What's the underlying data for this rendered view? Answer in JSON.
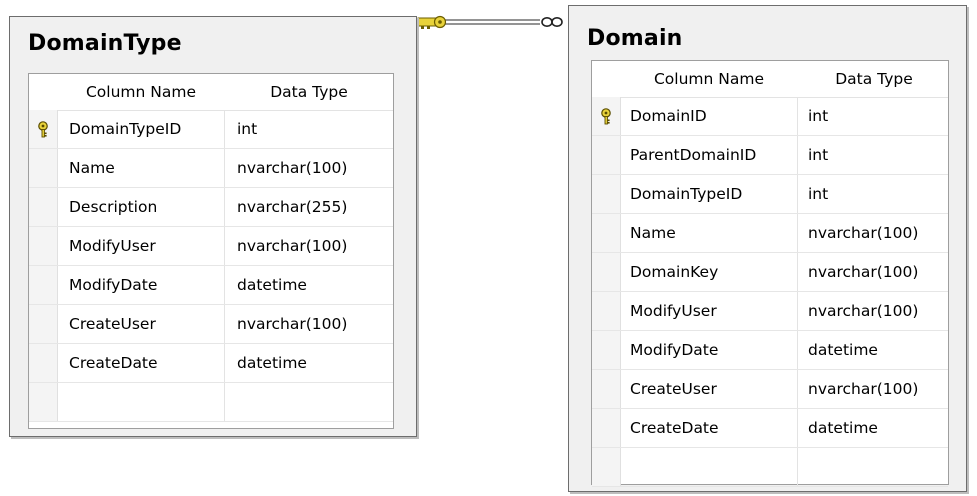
{
  "colors": {
    "background": "#ffffff",
    "box_background": "#f0f0f0",
    "border": "#6d6d6d",
    "key_yellow": "#e8d23a"
  },
  "relationship": {
    "one_end_icon": "key-icon",
    "many_end_icon": "infinity-icon"
  },
  "tables": [
    {
      "title": "DomainType",
      "header": {
        "column_name": "Column Name",
        "data_type": "Data Type"
      },
      "rows": [
        {
          "name": "DomainTypeID",
          "type": "int",
          "primary_key": true
        },
        {
          "name": "Name",
          "type": "nvarchar(100)",
          "primary_key": false
        },
        {
          "name": "Description",
          "type": "nvarchar(255)",
          "primary_key": false
        },
        {
          "name": "ModifyUser",
          "type": "nvarchar(100)",
          "primary_key": false
        },
        {
          "name": "ModifyDate",
          "type": "datetime",
          "primary_key": false
        },
        {
          "name": "CreateUser",
          "type": "nvarchar(100)",
          "primary_key": false
        },
        {
          "name": "CreateDate",
          "type": "datetime",
          "primary_key": false
        }
      ]
    },
    {
      "title": "Domain",
      "header": {
        "column_name": "Column Name",
        "data_type": "Data Type"
      },
      "rows": [
        {
          "name": "DomainID",
          "type": "int",
          "primary_key": true
        },
        {
          "name": "ParentDomainID",
          "type": "int",
          "primary_key": false
        },
        {
          "name": "DomainTypeID",
          "type": "int",
          "primary_key": false
        },
        {
          "name": "Name",
          "type": "nvarchar(100)",
          "primary_key": false
        },
        {
          "name": "DomainKey",
          "type": "nvarchar(100)",
          "primary_key": false
        },
        {
          "name": "ModifyUser",
          "type": "nvarchar(100)",
          "primary_key": false
        },
        {
          "name": "ModifyDate",
          "type": "datetime",
          "primary_key": false
        },
        {
          "name": "CreateUser",
          "type": "nvarchar(100)",
          "primary_key": false
        },
        {
          "name": "CreateDate",
          "type": "datetime",
          "primary_key": false
        }
      ]
    }
  ]
}
